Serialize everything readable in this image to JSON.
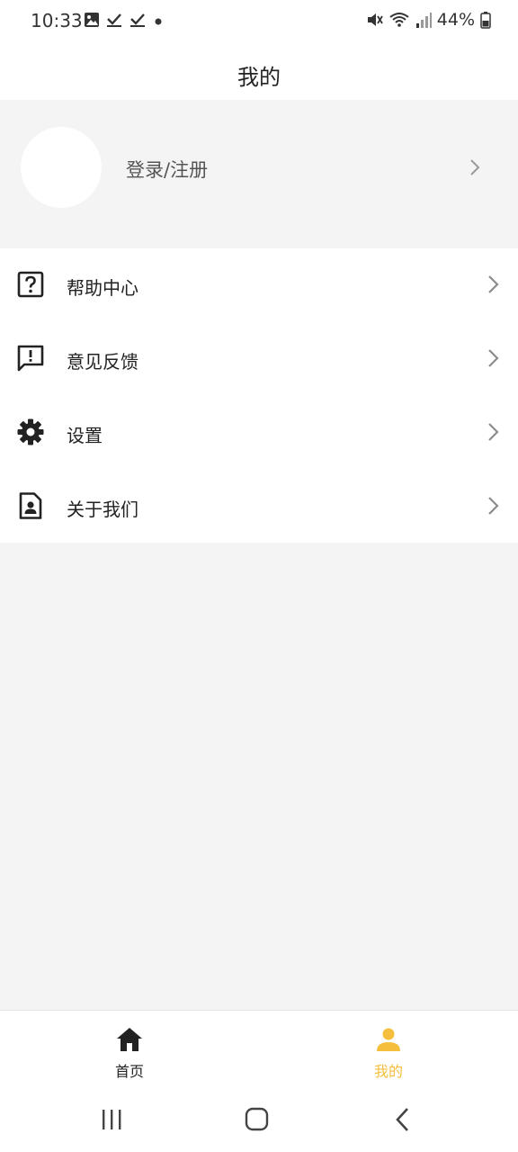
{
  "status_bar": {
    "time": "10:33",
    "battery": "44%",
    "left_icons": [
      "image-icon",
      "check-download-icon",
      "check-download-icon",
      "dot-icon"
    ],
    "right_icons": [
      "mute-icon",
      "wifi-icon",
      "signal-icon",
      "battery-icon"
    ]
  },
  "header": {
    "title": "我的"
  },
  "profile": {
    "login_label": "登录/注册"
  },
  "menu": {
    "items": [
      {
        "label": "帮助中心",
        "icon": "help-icon"
      },
      {
        "label": "意见反馈",
        "icon": "feedback-icon"
      },
      {
        "label": "设置",
        "icon": "gear-icon"
      },
      {
        "label": "关于我们",
        "icon": "contact-file-icon"
      }
    ]
  },
  "tabbar": {
    "tabs": [
      {
        "label": "首页",
        "icon": "home-icon",
        "active": false
      },
      {
        "label": "我的",
        "icon": "person-icon",
        "active": true
      }
    ]
  },
  "colors": {
    "accent": "#f5be3c",
    "background": "#f4f4f4",
    "text": "#222222"
  }
}
